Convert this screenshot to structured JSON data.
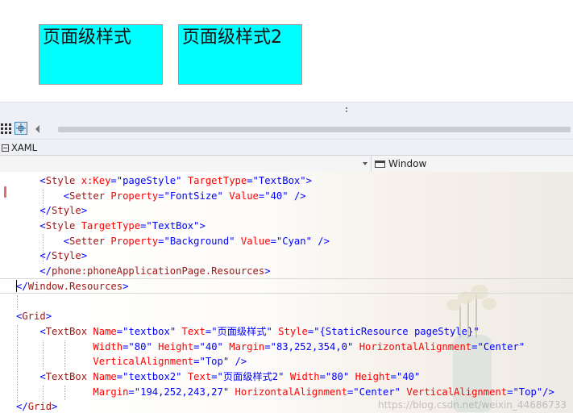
{
  "preview": {
    "box1": "页面级样式",
    "box2": "页面级样式2",
    "fill_color": "#00ffff"
  },
  "toolbar": {
    "grid_icon": "grid-icon",
    "pointer_icon": "pointer-icon",
    "arrow_icon": "scroll-left-icon"
  },
  "tab": {
    "label": "XAML",
    "icon": "xaml-icon"
  },
  "navbar": {
    "right_label": "Window",
    "right_icon": "window-icon"
  },
  "code_lines": [
    [
      [
        "punc",
        "    <"
      ],
      [
        "tag",
        "Style "
      ],
      [
        "attr",
        "x:Key"
      ],
      [
        "punc",
        "=\""
      ],
      [
        "val",
        "pageStyle"
      ],
      [
        "punc",
        "\" "
      ],
      [
        "attr",
        "TargetType"
      ],
      [
        "punc",
        "=\""
      ],
      [
        "val",
        "TextBox"
      ],
      [
        "punc",
        "\">"
      ]
    ],
    [
      [
        "punc",
        "        <"
      ],
      [
        "tag",
        "Setter "
      ],
      [
        "attr",
        "Property"
      ],
      [
        "punc",
        "=\""
      ],
      [
        "val",
        "FontSize"
      ],
      [
        "punc",
        "\" "
      ],
      [
        "attr",
        "Value"
      ],
      [
        "punc",
        "=\""
      ],
      [
        "val",
        "40"
      ],
      [
        "punc",
        "\" />"
      ]
    ],
    [
      [
        "punc",
        "    </"
      ],
      [
        "tag",
        "Style"
      ],
      [
        "punc",
        ">"
      ]
    ],
    [
      [
        "punc",
        "    <"
      ],
      [
        "tag",
        "Style "
      ],
      [
        "attr",
        "TargetType"
      ],
      [
        "punc",
        "=\""
      ],
      [
        "val",
        "TextBox"
      ],
      [
        "punc",
        "\">"
      ]
    ],
    [
      [
        "punc",
        "        <"
      ],
      [
        "tag",
        "Setter "
      ],
      [
        "attr",
        "Property"
      ],
      [
        "punc",
        "=\""
      ],
      [
        "val",
        "Background"
      ],
      [
        "punc",
        "\" "
      ],
      [
        "attr",
        "Value"
      ],
      [
        "punc",
        "=\""
      ],
      [
        "val",
        "Cyan"
      ],
      [
        "punc",
        "\" />"
      ]
    ],
    [
      [
        "punc",
        "    </"
      ],
      [
        "tag",
        "Style"
      ],
      [
        "punc",
        ">"
      ]
    ],
    [
      [
        "punc",
        "    </"
      ],
      [
        "tag",
        "phone:phoneApplicationPage.Resources"
      ],
      [
        "punc",
        ">"
      ]
    ],
    [
      [
        "punc",
        "</"
      ],
      [
        "tag",
        "Window.Resources"
      ],
      [
        "punc",
        ">"
      ]
    ],
    [
      [
        "punc",
        ""
      ]
    ],
    [
      [
        "punc",
        "<"
      ],
      [
        "tag",
        "Grid"
      ],
      [
        "punc",
        ">"
      ]
    ],
    [
      [
        "punc",
        "    <"
      ],
      [
        "tag",
        "TextBox "
      ],
      [
        "attr",
        "Name"
      ],
      [
        "punc",
        "=\""
      ],
      [
        "val",
        "textbox"
      ],
      [
        "punc",
        "\" "
      ],
      [
        "attr",
        "Text"
      ],
      [
        "punc",
        "=\""
      ],
      [
        "val",
        "页面级样式"
      ],
      [
        "punc",
        "\" "
      ],
      [
        "attr",
        "Style"
      ],
      [
        "punc",
        "=\""
      ],
      [
        "val",
        "{StaticResource pageStyle}"
      ],
      [
        "punc",
        "\""
      ]
    ],
    [
      [
        "punc",
        "             "
      ],
      [
        "attr",
        "Width"
      ],
      [
        "punc",
        "=\""
      ],
      [
        "val",
        "80"
      ],
      [
        "punc",
        "\" "
      ],
      [
        "attr",
        "Height"
      ],
      [
        "punc",
        "=\""
      ],
      [
        "val",
        "40"
      ],
      [
        "punc",
        "\" "
      ],
      [
        "attr",
        "Margin"
      ],
      [
        "punc",
        "=\""
      ],
      [
        "val",
        "83,252,354,0"
      ],
      [
        "punc",
        "\" "
      ],
      [
        "attr",
        "HorizontalAlignment"
      ],
      [
        "punc",
        "=\""
      ],
      [
        "val",
        "Center"
      ],
      [
        "punc",
        "\""
      ]
    ],
    [
      [
        "punc",
        "             "
      ],
      [
        "attr",
        "VerticalAlignment"
      ],
      [
        "punc",
        "=\""
      ],
      [
        "val",
        "Top"
      ],
      [
        "punc",
        "\" />"
      ]
    ],
    [
      [
        "punc",
        "    <"
      ],
      [
        "tag",
        "TextBox "
      ],
      [
        "attr",
        "Name"
      ],
      [
        "punc",
        "=\""
      ],
      [
        "val",
        "textbox2"
      ],
      [
        "punc",
        "\" "
      ],
      [
        "attr",
        "Text"
      ],
      [
        "punc",
        "=\""
      ],
      [
        "val",
        "页面级样式2"
      ],
      [
        "punc",
        "\" "
      ],
      [
        "attr",
        "Width"
      ],
      [
        "punc",
        "=\""
      ],
      [
        "val",
        "80"
      ],
      [
        "punc",
        "\" "
      ],
      [
        "attr",
        "Height"
      ],
      [
        "punc",
        "=\""
      ],
      [
        "val",
        "40"
      ],
      [
        "punc",
        "\""
      ]
    ],
    [
      [
        "punc",
        "             "
      ],
      [
        "attr",
        "Margin"
      ],
      [
        "punc",
        "=\""
      ],
      [
        "val",
        "194,252,243,27"
      ],
      [
        "punc",
        "\" "
      ],
      [
        "attr",
        "HorizontalAlignment"
      ],
      [
        "punc",
        "=\""
      ],
      [
        "val",
        "Center"
      ],
      [
        "punc",
        "\" "
      ],
      [
        "attr",
        "VerticalAlignment"
      ],
      [
        "punc",
        "=\""
      ],
      [
        "val",
        "Top"
      ],
      [
        "punc",
        "\"/>"
      ]
    ],
    [
      [
        "punc",
        "</"
      ],
      [
        "tag",
        "Grid"
      ],
      [
        "punc",
        ">"
      ]
    ]
  ],
  "colors": {
    "tag": "#a31515",
    "attr": "#ff0000",
    "value": "#0000ff",
    "punctuation": "#0000ff"
  },
  "watermark": "https://blog.csdn.net/weixin_44686733"
}
